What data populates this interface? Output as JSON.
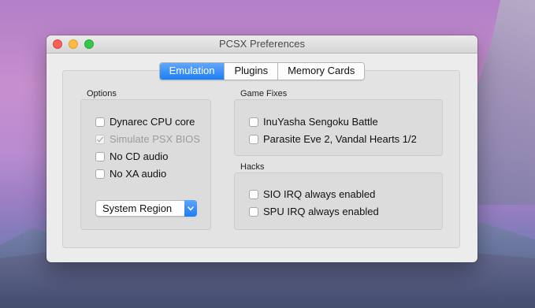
{
  "window": {
    "title": "PCSX Preferences"
  },
  "tabs": [
    {
      "label": "Emulation",
      "active": true
    },
    {
      "label": "Plugins",
      "active": false
    },
    {
      "label": "Memory Cards",
      "active": false
    }
  ],
  "options": {
    "label": "Options",
    "items": [
      {
        "label": "Dynarec CPU core",
        "checked": false,
        "enabled": true
      },
      {
        "label": "Simulate PSX BIOS",
        "checked": true,
        "enabled": false
      },
      {
        "label": "No CD audio",
        "checked": false,
        "enabled": true
      },
      {
        "label": "No XA audio",
        "checked": false,
        "enabled": true
      }
    ],
    "region_select": {
      "value": "System Region"
    }
  },
  "game_fixes": {
    "label": "Game Fixes",
    "items": [
      {
        "label": "InuYasha Sengoku Battle",
        "checked": false
      },
      {
        "label": "Parasite Eve 2, Vandal Hearts 1/2",
        "checked": false
      }
    ]
  },
  "hacks": {
    "label": "Hacks",
    "items": [
      {
        "label": "SIO IRQ always enabled",
        "checked": false
      },
      {
        "label": "SPU IRQ always enabled",
        "checked": false
      }
    ]
  },
  "colors": {
    "accent": "#1c7ef4",
    "window_bg": "#ececec",
    "close": "#fc605b",
    "minimize": "#fdbc40",
    "zoom": "#34c84a"
  }
}
